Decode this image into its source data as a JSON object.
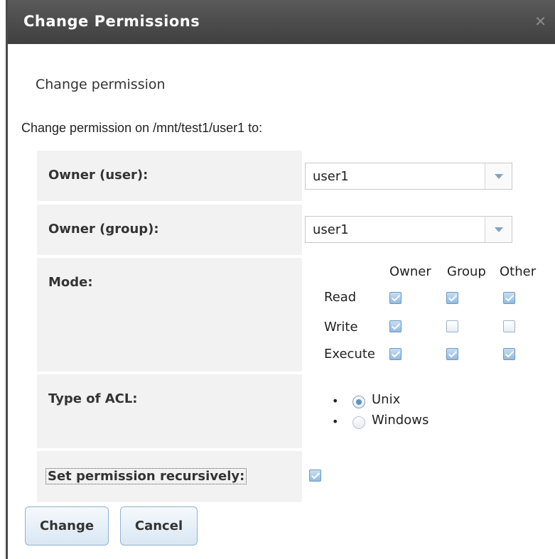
{
  "dialog": {
    "title": "Change Permissions",
    "close_icon": "close-icon"
  },
  "form": {
    "heading": "Change permission",
    "description": "Change permission on /mnt/test1/user1 to:",
    "owner_user": {
      "label": "Owner (user):",
      "value": "user1"
    },
    "owner_group": {
      "label": "Owner (group):",
      "value": "user1"
    },
    "mode": {
      "label": "Mode:",
      "columns": [
        "Owner",
        "Group",
        "Other"
      ],
      "rows": [
        {
          "label": "Read",
          "values": [
            true,
            true,
            true
          ]
        },
        {
          "label": "Write",
          "values": [
            true,
            false,
            false
          ]
        },
        {
          "label": "Execute",
          "values": [
            true,
            true,
            true
          ]
        }
      ]
    },
    "acl": {
      "label": "Type of ACL:",
      "options": [
        {
          "label": "Unix",
          "selected": true
        },
        {
          "label": "Windows",
          "selected": false
        }
      ]
    },
    "recursive": {
      "label": "Set permission recursively:",
      "checked": true
    }
  },
  "buttons": {
    "change": "Change",
    "cancel": "Cancel"
  },
  "colors": {
    "accent": "#6f98c2",
    "titlebar": "#4a4a4a"
  }
}
